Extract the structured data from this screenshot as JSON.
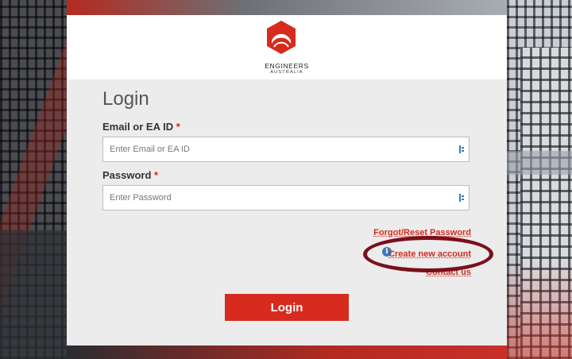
{
  "brand": {
    "name": "ENGINEERS",
    "subname": "AUSTRALIA",
    "accent_color": "#d62b1e",
    "icon": "engineers-australia-logo"
  },
  "login": {
    "title": "Login",
    "email_label": "Email or EA ID",
    "email_placeholder": "Enter Email or EA ID",
    "password_label": "Password",
    "password_placeholder": "Enter Password",
    "required_marker": "*",
    "field_icon": "password-manager-icon",
    "forgot_link": "Forgot/Reset Password",
    "create_account_link": "Create new account",
    "info_icon": "info-icon",
    "info_glyph": "i",
    "contact_link": "Contact us",
    "submit_label": "Login"
  },
  "annotation": {
    "highlight": "create-new-account-link",
    "highlight_color": "#7b0f1c"
  }
}
